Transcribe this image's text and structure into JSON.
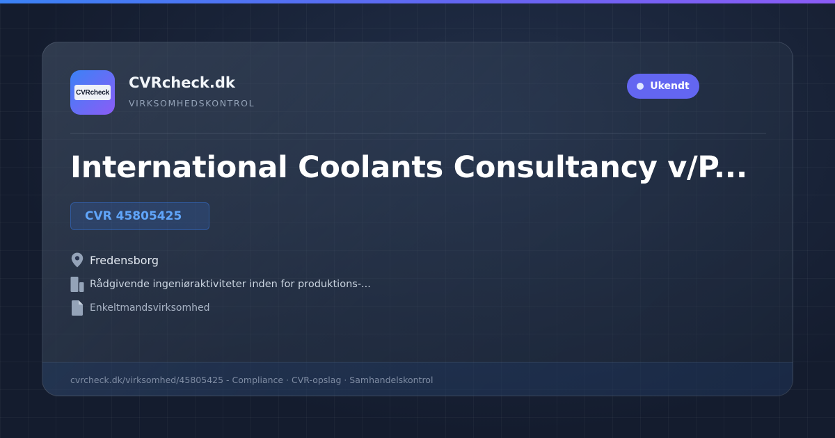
{
  "colors": {
    "accent": "#6366f1",
    "cvr_text": "#60a5fa",
    "background": "#141c2e"
  },
  "brand": {
    "logo_text": "CVRcheck",
    "name": "CVRcheck.dk",
    "subtitle": "VIRKSOMHEDSKONTROL"
  },
  "status": {
    "label": "Ukendt"
  },
  "company": {
    "name": "International Coolants Consultancy v/P...",
    "cvr": "CVR 45805425",
    "location": "Fredensborg",
    "industry": "Rådgivende ingeniøraktiviteter inden for produktions-...",
    "company_type": "Enkeltmandsvirksomhed"
  },
  "icons": {
    "location": "map-pin-icon",
    "industry": "building-icon",
    "company_type": "document-icon"
  },
  "footer": {
    "text": "cvrcheck.dk/virksomhed/45805425 - Compliance · CVR-opslag · Samhandelskontrol"
  }
}
